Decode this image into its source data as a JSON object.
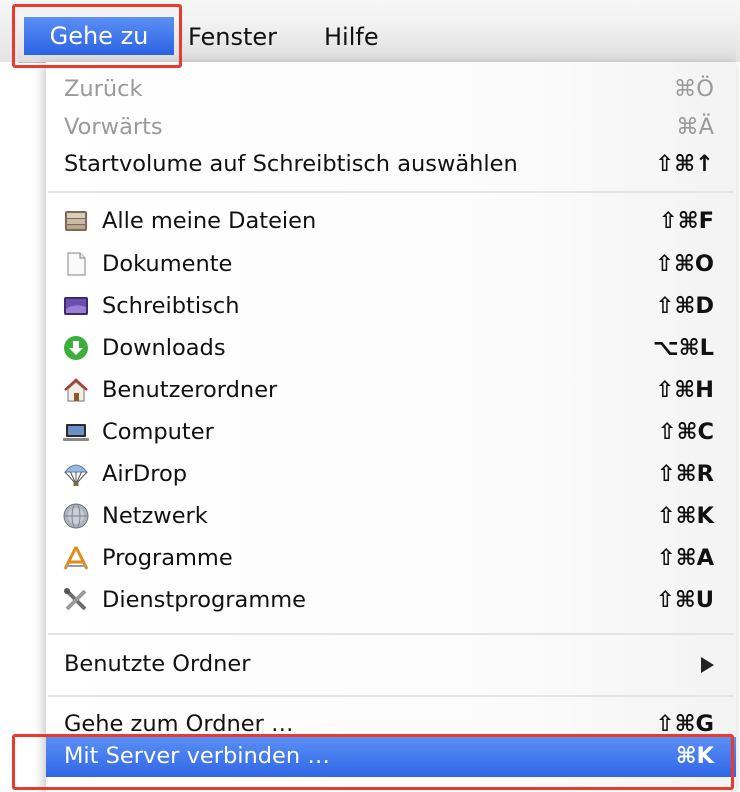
{
  "menubar": {
    "items": [
      {
        "label": "Gehe zu"
      },
      {
        "label": "Fenster"
      },
      {
        "label": "Hilfe"
      }
    ]
  },
  "menu": {
    "items": [
      {
        "label": "Zurück",
        "shortcut": "⌘Ö",
        "enabled": false
      },
      {
        "label": "Vorwärts",
        "shortcut": "⌘Ä",
        "enabled": false
      },
      {
        "label": "Startvolume auf Schreibtisch auswählen",
        "shortcut": "⇧⌘↑",
        "enabled": true
      },
      {
        "label": "Alle meine Dateien",
        "shortcut": "⇧⌘F",
        "icon": "all-files-icon"
      },
      {
        "label": "Dokumente",
        "shortcut": "⇧⌘O",
        "icon": "document-icon"
      },
      {
        "label": "Schreibtisch",
        "shortcut": "⇧⌘D",
        "icon": "desktop-icon"
      },
      {
        "label": "Downloads",
        "shortcut": "⌥⌘L",
        "icon": "downloads-icon"
      },
      {
        "label": "Benutzerordner",
        "shortcut": "⇧⌘H",
        "icon": "home-icon"
      },
      {
        "label": "Computer",
        "shortcut": "⇧⌘C",
        "icon": "computer-icon"
      },
      {
        "label": "AirDrop",
        "shortcut": "⇧⌘R",
        "icon": "airdrop-icon"
      },
      {
        "label": "Netzwerk",
        "shortcut": "⇧⌘K",
        "icon": "network-icon"
      },
      {
        "label": "Programme",
        "shortcut": "⇧⌘A",
        "icon": "applications-icon"
      },
      {
        "label": "Dienstprogramme",
        "shortcut": "⇧⌘U",
        "icon": "utilities-icon"
      },
      {
        "label": "Benutzte Ordner",
        "submenu": true
      },
      {
        "label": "Gehe zum Ordner …",
        "shortcut": "⇧⌘G"
      },
      {
        "label": "Mit Server verbinden …",
        "shortcut": "⌘K",
        "selected": true
      }
    ]
  },
  "colors": {
    "selection": "#2f66e6",
    "highlight_box": "#ea3a2d"
  }
}
